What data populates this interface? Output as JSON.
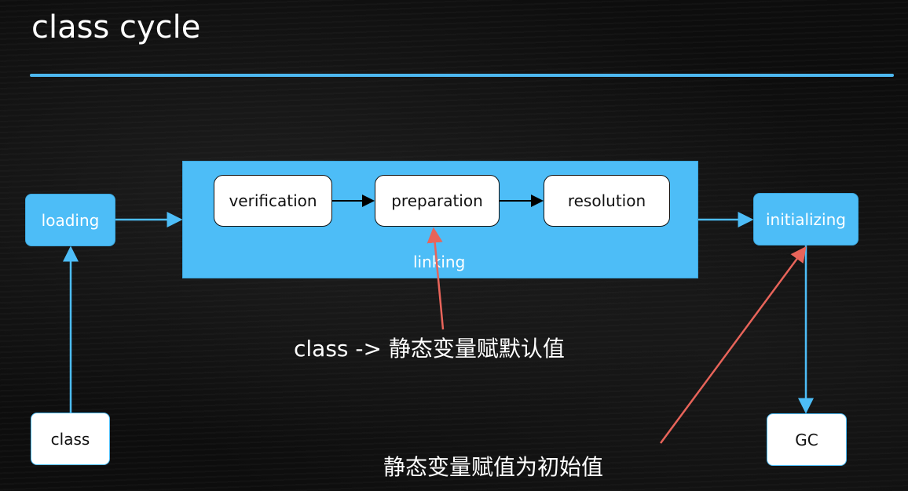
{
  "title": "class cycle",
  "nodes": {
    "loading": "loading",
    "class": "class",
    "linking": "linking",
    "verification": "verification",
    "preparation": "preparation",
    "resolution": "resolution",
    "initializing": "initializing",
    "gc": "GC"
  },
  "annotations": {
    "preparation_note": "class -> 静态变量赋默认值",
    "initializing_note": "静态变量赋值为初始值"
  },
  "colors": {
    "accent": "#4dbdf7",
    "annotation_arrow": "#e8645a",
    "background": "#0d0d0d"
  }
}
